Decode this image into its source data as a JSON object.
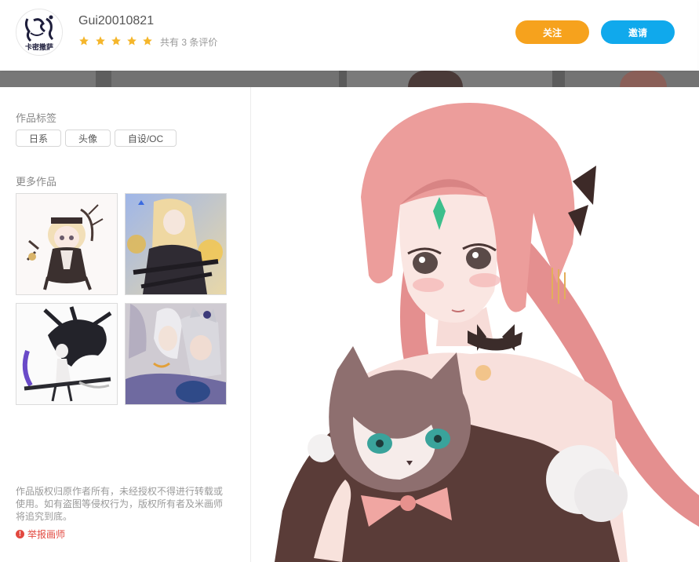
{
  "header": {
    "avatar_text": "卡密撒萨",
    "username": "Gui20010821",
    "rating": 5,
    "review_count": "共有 3 条评价",
    "follow_label": "关注",
    "invite_label": "邀请"
  },
  "sidebar": {
    "tags_title": "作品标签",
    "tags": [
      "日系",
      "头像",
      "自设/OC"
    ],
    "more_title": "更多作品",
    "works": [
      {
        "name": "work-1"
      },
      {
        "name": "work-2"
      },
      {
        "name": "work-3"
      },
      {
        "name": "work-4"
      }
    ],
    "copyright": "作品版权归原作者所有，未经授权不得进行转载或使用。如有盗图等侵权行为，版权所有者及米画师将追究到底。",
    "report_label": "举报画师"
  },
  "colors": {
    "accent_orange": "#f6a21d",
    "accent_blue": "#10a9ec",
    "star": "#f5b62b",
    "report": "#e2483f"
  }
}
